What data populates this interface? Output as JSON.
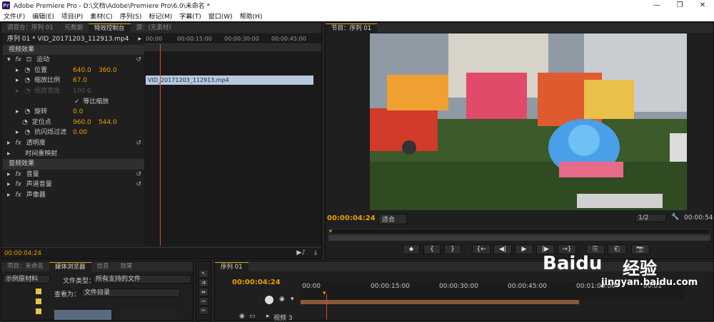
{
  "window": {
    "app_logo": "Pr",
    "title": "Adobe Premiere Pro - D:\\文档\\Adobe\\Premiere Pro\\6.0\\未命名 *",
    "minimize": "—",
    "restore": "❐",
    "close": "✕"
  },
  "menu": [
    "文件(F)",
    "编辑(E)",
    "项目(P)",
    "素材(C)",
    "序列(S)",
    "标记(M)",
    "字幕(T)",
    "窗口(W)",
    "帮助(H)"
  ],
  "effect_controls": {
    "tabs": [
      "调音台：序列 01",
      "元数据",
      "特效控制台",
      "源：(无素材)"
    ],
    "sequence_label": "序列 01 * VID_20171203_112913.mp4",
    "clip_name": "VID_20171203_112913.mp4",
    "ruler_times": [
      "00:00",
      "00:00:15:00",
      "00:00:30:00",
      "00:00:45:00"
    ],
    "video_effects": "视频效果",
    "motion": "运动",
    "position": {
      "label": "位置",
      "x": "640.0",
      "y": "360.0"
    },
    "scale": {
      "label": "缩放比例",
      "value": "67.0"
    },
    "scale_width": {
      "label": "缩放宽度",
      "value": "100.0"
    },
    "uniform_scale": "等比缩放",
    "rotation": {
      "label": "旋转",
      "value": "0.0"
    },
    "anchor": {
      "label": "定位点",
      "x": "960.0",
      "y": "544.0"
    },
    "flicker": {
      "label": "抗闪烁过滤",
      "value": "0.00"
    },
    "opacity": "透明度",
    "time_remap": "时间重映射",
    "audio_effects": "音频效果",
    "volume": "音量",
    "channel_volume": "声道音量",
    "panner": "声像器",
    "timecode": "00:00:04:24",
    "fx": "fx",
    "reset": "↺"
  },
  "program_monitor": {
    "tab": "节目：序列 01",
    "timecode": "00:00:04:24",
    "fit": "适合",
    "quality": "1/2",
    "end_time": "00:00:54",
    "controls": [
      "⬥",
      "{",
      "}",
      "{←",
      "◀|",
      "▶",
      "|▶",
      "→}",
      "⎘",
      "⎗",
      "📷"
    ]
  },
  "project": {
    "tabs": [
      "项目：未命名",
      "媒体浏览器",
      "信息",
      "效果"
    ],
    "dropdown": "示例原材料",
    "file_type_label": "文件类型：",
    "file_type": "所有支持的文件",
    "view_as_label": "查看为：",
    "view_as": "文件目录"
  },
  "timeline": {
    "tab": "序列 01",
    "timecode": "00:00:04:24",
    "ruler_times": [
      "00:00",
      "00:00:15:00",
      "00:00:30:00",
      "00:00:45:00",
      "00:01:00:00",
      "00:01"
    ],
    "track": "视频 3"
  },
  "watermark": {
    "brand": "Baidu",
    "brand_cn": "经验",
    "url": "jingyan.baidu.com"
  },
  "colors": {
    "accent": "#e8a000",
    "playhead": "#e04040",
    "clip": "#b9c8e0"
  }
}
